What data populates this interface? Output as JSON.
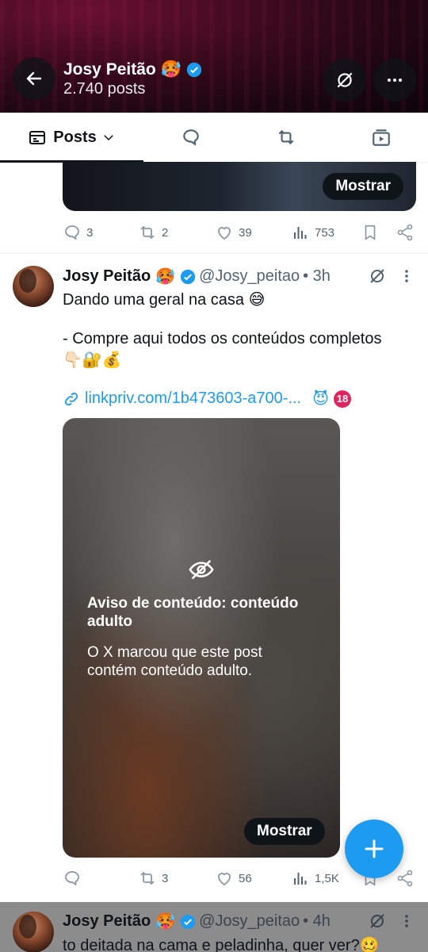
{
  "profile": {
    "name": "Josy Peitão",
    "name_emoji": "🥵",
    "posts_count": "2.740 posts"
  },
  "tabs": {
    "posts_label": "Posts"
  },
  "prev_tweet": {
    "show_label": "Mostrar",
    "replies": "3",
    "reposts": "2",
    "likes": "39",
    "views": "753"
  },
  "tweet": {
    "name": "Josy Peitão",
    "name_emoji": "🥵",
    "handle": "@Josy_peitao",
    "time": "• 3h",
    "line1": "Dando uma geral na casa 😅",
    "line2": "- Compre aqui todos os conteúdos completos",
    "line3": "👇🏻🔐💰",
    "link": "linkpriv.com/1b473603-a700-...",
    "link_emojis": "😈",
    "link_badge": "18",
    "warning_title": "Aviso de conteúdo: conteúdo adulto",
    "warning_sub": "O X marcou que este post contém conteúdo adulto.",
    "show_label": "Mostrar",
    "replies": "",
    "reposts": "3",
    "likes": "56",
    "views": "1,5K"
  },
  "next_tweet": {
    "name": "Josy Peitão",
    "name_emoji": "🥵",
    "handle": "@Josy_peitao",
    "time": "• 4h",
    "text": "to deitada na cama e peladinha, quer ver?🥴"
  },
  "colors": {
    "accent": "#1d9bf0",
    "text": "#0f1419",
    "muted": "#536471"
  }
}
